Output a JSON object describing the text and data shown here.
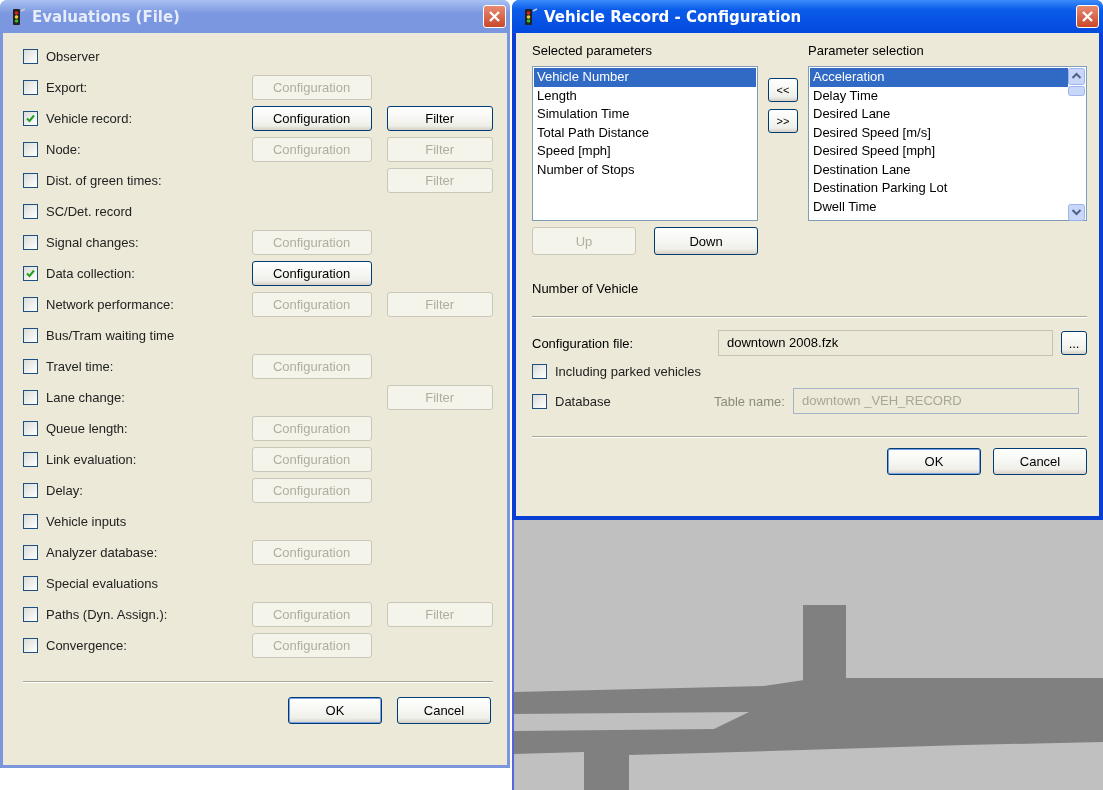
{
  "evaluations_window": {
    "title": "Evaluations (File)",
    "active": false,
    "rows": [
      {
        "label": "Observer",
        "checked": false
      },
      {
        "label": "Export:",
        "checked": false,
        "configuration": {
          "label": "Configuration",
          "disabled": true
        }
      },
      {
        "label": "Vehicle record:",
        "checked": true,
        "configuration": {
          "label": "Configuration",
          "disabled": false
        },
        "filter": {
          "label": "Filter",
          "disabled": false
        }
      },
      {
        "label": "Node:",
        "checked": false,
        "configuration": {
          "label": "Configuration",
          "disabled": true
        },
        "filter": {
          "label": "Filter",
          "disabled": true
        }
      },
      {
        "label": "Dist. of green times:",
        "checked": false,
        "filter": {
          "label": "Filter",
          "disabled": true
        }
      },
      {
        "label": "SC/Det. record",
        "checked": false
      },
      {
        "label": "Signal changes:",
        "checked": false,
        "configuration": {
          "label": "Configuration",
          "disabled": true
        }
      },
      {
        "label": "Data collection:",
        "checked": true,
        "configuration": {
          "label": "Configuration",
          "disabled": false
        }
      },
      {
        "label": "Network performance:",
        "checked": false,
        "configuration": {
          "label": "Configuration",
          "disabled": true
        },
        "filter": {
          "label": "Filter",
          "disabled": true
        }
      },
      {
        "label": "Bus/Tram waiting time",
        "checked": false
      },
      {
        "label": "Travel time:",
        "checked": false,
        "configuration": {
          "label": "Configuration",
          "disabled": true
        }
      },
      {
        "label": "Lane change:",
        "checked": false,
        "filter": {
          "label": "Filter",
          "disabled": true
        }
      },
      {
        "label": "Queue length:",
        "checked": false,
        "configuration": {
          "label": "Configuration",
          "disabled": true
        }
      },
      {
        "label": "Link evaluation:",
        "checked": false,
        "configuration": {
          "label": "Configuration",
          "disabled": true
        }
      },
      {
        "label": "Delay:",
        "checked": false,
        "configuration": {
          "label": "Configuration",
          "disabled": true
        }
      },
      {
        "label": "Vehicle inputs",
        "checked": false
      },
      {
        "label": "Analyzer database:",
        "checked": false,
        "configuration": {
          "label": "Configuration",
          "disabled": true
        }
      },
      {
        "label": "Special evaluations",
        "checked": false
      },
      {
        "label": "Paths (Dyn. Assign.):",
        "checked": false,
        "configuration": {
          "label": "Configuration",
          "disabled": true
        },
        "filter": {
          "label": "Filter",
          "disabled": true
        }
      },
      {
        "label": "Convergence:",
        "checked": false,
        "configuration": {
          "label": "Configuration",
          "disabled": true
        }
      }
    ],
    "buttons": [
      "OK",
      "Cancel"
    ]
  },
  "config_window": {
    "title": "Vehicle Record - Configuration",
    "active": true,
    "selected_parameters": {
      "label": "Selected parameters",
      "items": [
        {
          "label": "Vehicle Number",
          "selected": true
        },
        {
          "label": "Length",
          "selected": false
        },
        {
          "label": "Simulation Time",
          "selected": false
        },
        {
          "label": "Total Path Distance",
          "selected": false
        },
        {
          "label": "Speed [mph]",
          "selected": false
        },
        {
          "label": "Number of Stops",
          "selected": false
        }
      ]
    },
    "move_buttons": [
      "<<",
      ">>"
    ],
    "parameter_selection": {
      "label": "Parameter selection",
      "items": [
        {
          "label": "Acceleration",
          "selected": true
        },
        {
          "label": "Delay Time",
          "selected": false
        },
        {
          "label": "Desired Lane",
          "selected": false
        },
        {
          "label": "Desired Speed [m/s]",
          "selected": false
        },
        {
          "label": "Desired Speed [mph]",
          "selected": false
        },
        {
          "label": "Destination Lane",
          "selected": false
        },
        {
          "label": "Destination Parking Lot",
          "selected": false
        },
        {
          "label": "Dwell Time",
          "selected": false
        }
      ]
    },
    "order_buttons": [
      {
        "label": "Up",
        "disabled": true
      },
      {
        "label": "Down",
        "disabled": false
      }
    ],
    "description": "Number of Vehicle",
    "configuration_file": {
      "label": "Configuration file:",
      "value": "downtown 2008.fzk",
      "browse": "..."
    },
    "including_parked": {
      "label": "Including parked vehicles",
      "checked": false
    },
    "database": {
      "label": "Database",
      "checked": false,
      "table_label": "Table name:",
      "table_value": "downtown _VEH_RECORD",
      "disabled": true
    },
    "buttons": [
      "OK",
      "Cancel"
    ]
  }
}
